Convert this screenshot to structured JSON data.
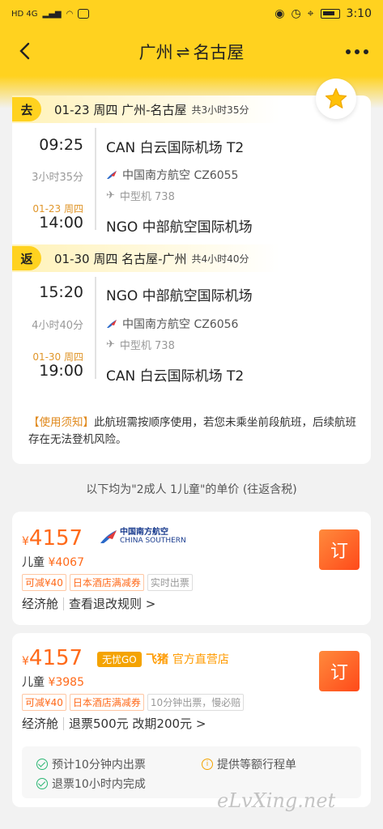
{
  "status": {
    "left": "HD 4G",
    "time": "3:10"
  },
  "nav": {
    "title_from": "广州",
    "swap": "⇌",
    "title_to": "名古屋"
  },
  "outbound": {
    "tag": "去",
    "header": "01-23 周四 广州-名古屋",
    "duration_label": "共3小时35分",
    "dep_time": "09:25",
    "dep_airport": "CAN 白云国际机场 T2",
    "flight_duration": "3小时35分",
    "airline": "中国南方航空 CZ6055",
    "aircraft": "中型机 738",
    "arr_date": "01-23 周四",
    "arr_time": "14:00",
    "arr_airport": "NGO 中部航空国际机场"
  },
  "return": {
    "tag": "返",
    "header": "01-30 周四 名古屋-广州",
    "duration_label": "共4小时40分",
    "dep_time": "15:20",
    "dep_airport": "NGO 中部航空国际机场",
    "flight_duration": "4小时40分",
    "airline": "中国南方航空 CZ6056",
    "aircraft": "中型机 738",
    "arr_date": "01-30 周四",
    "arr_time": "19:00",
    "arr_airport": "CAN 白云国际机场 T2"
  },
  "notice": {
    "label": "【使用须知】",
    "text": "此航班需按顺序使用，若您未乘坐前段航班，后续航班存在无法登机风险。"
  },
  "price_note": "以下均为\"2成人 1儿童\"的单价 (往返含税)",
  "offers": [
    {
      "currency": "¥",
      "price": "4157",
      "airline_logo_cn": "中国南方航空",
      "airline_logo_en": "CHINA SOUTHERN",
      "child": "儿童",
      "child_price": "¥4067",
      "tags": [
        "可减¥40",
        "日本酒店满减券",
        "实时出票"
      ],
      "cabin": "经济舱",
      "rule": "查看退改规则 >",
      "book": "订"
    },
    {
      "currency": "¥",
      "price": "4157",
      "badge": "无忧GO",
      "seller_brand": "飞猪",
      "seller_text": "官方直营店",
      "child": "儿童",
      "child_price": "¥3985",
      "tags": [
        "可减¥40",
        "日本酒店满减券",
        "10分钟出票，慢必赔"
      ],
      "cabin": "经济舱",
      "rule": "退票500元 改期200元 >",
      "book": "订",
      "promises": [
        "预计10分钟内出票",
        "提供等额行程单",
        "退票10小时内完成"
      ]
    }
  ],
  "watermark": "eLvXing.net",
  "colors": {
    "brand_yellow": "#ffd21f",
    "price_orange": "#ff6a1a",
    "notice_orange": "#e08a1e"
  }
}
